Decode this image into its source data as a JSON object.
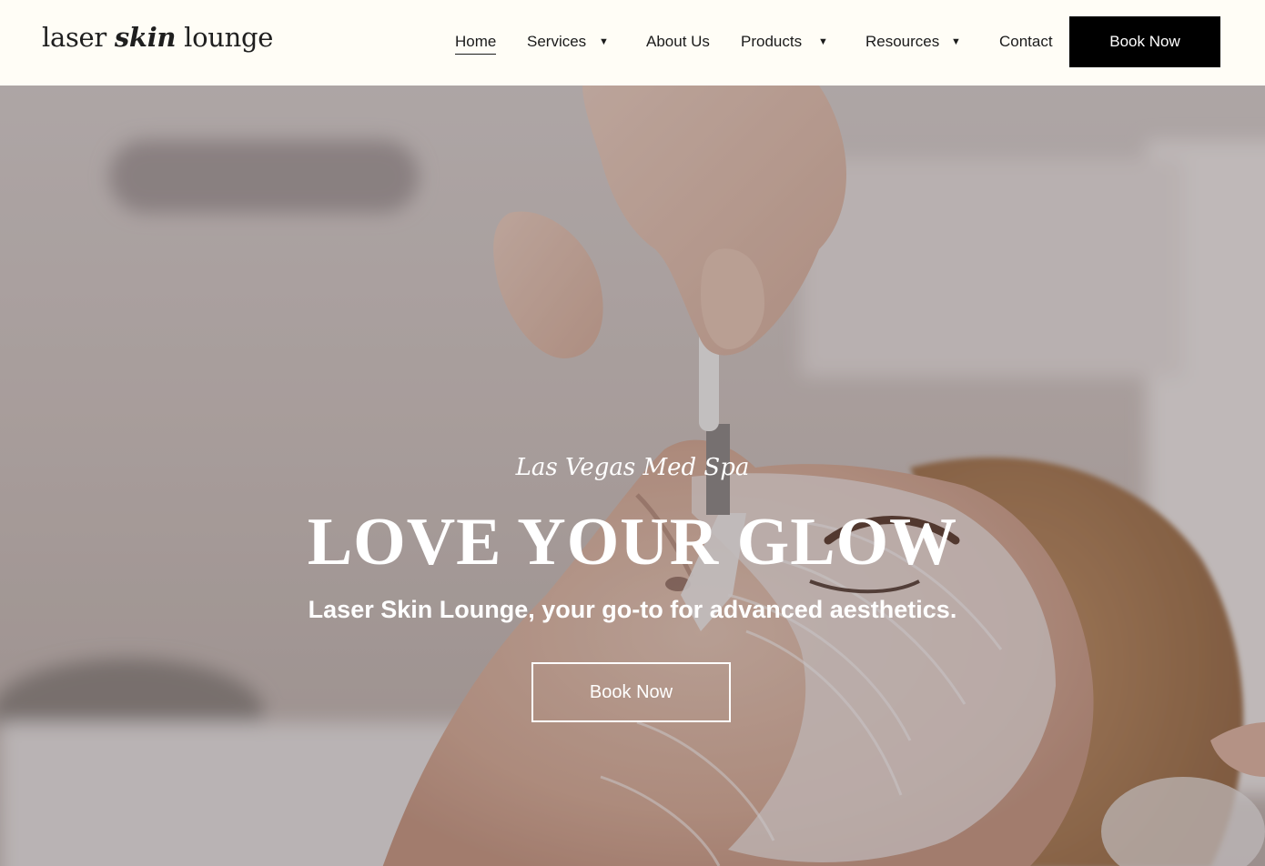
{
  "brand": {
    "logo_part1": "laser ",
    "logo_part2": "skin",
    "logo_part3": " lounge"
  },
  "nav": {
    "items": [
      {
        "label": "Home",
        "active": true,
        "has_dropdown": false
      },
      {
        "label": "Services",
        "active": false,
        "has_dropdown": true
      },
      {
        "label": "About Us",
        "active": false,
        "has_dropdown": false
      },
      {
        "label": "Products",
        "active": false,
        "has_dropdown": true
      },
      {
        "label": "Resources",
        "active": false,
        "has_dropdown": true
      },
      {
        "label": "Contact",
        "active": false,
        "has_dropdown": false
      }
    ],
    "caret_glyph": "▼",
    "cta_label": "Book Now"
  },
  "hero": {
    "eyebrow": "Las Vegas Med Spa",
    "title": "LOVE YOUR GLOW",
    "subtitle": "Laser Skin Lounge, your go-to for advanced aesthetics.",
    "cta_label": "Book Now",
    "image_subject": "facial-mask-treatment-photo"
  },
  "colors": {
    "header_bg": "#fffdf6",
    "cta_bg": "#000000",
    "text_dark": "#1b1b1b",
    "hero_text": "#ffffff"
  }
}
